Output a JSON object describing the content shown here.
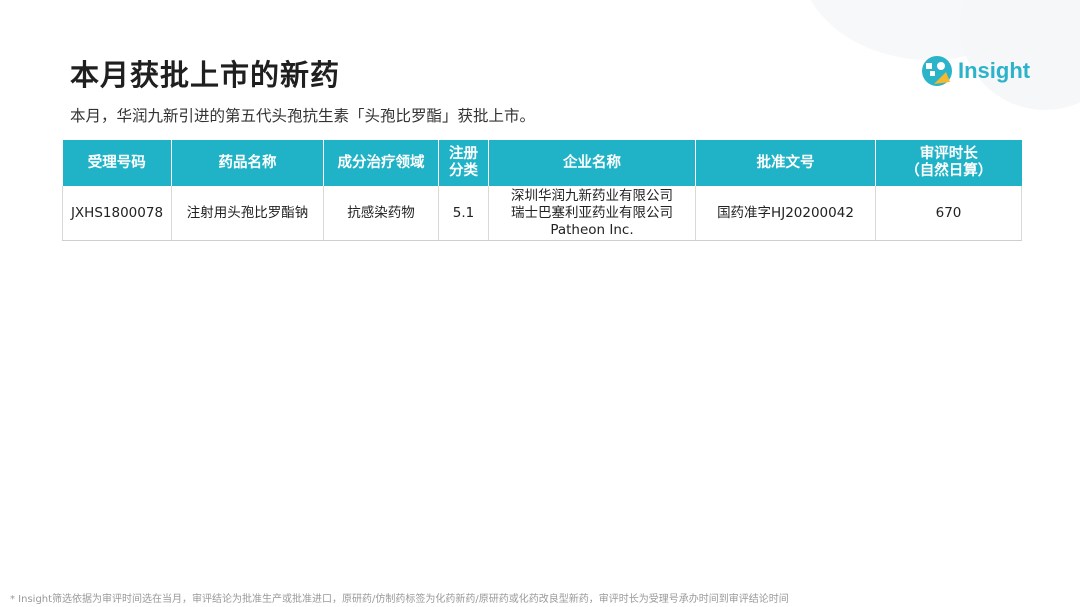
{
  "page": {
    "title": "本月获批上市的新药",
    "subtitle": "本月，华润九新引进的第五代头孢抗生素「头孢比罗酯」获批上市。",
    "footnote": "* Insight筛选依据为审评时间选在当月，审评结论为批准生产或批准进口，原研药/仿制药标签为化药新药/原研药或化药改良型新药，审评时长为受理号承办时间到审评结论时间"
  },
  "logo": {
    "text": "Insight",
    "icon": "insight-logo-icon",
    "color": "#2bb3c9"
  },
  "colors": {
    "header_bg": "#20b2c6",
    "header_text": "#ffffff"
  },
  "table": {
    "headers": [
      [
        "受理号码"
      ],
      [
        "药品名称"
      ],
      [
        "成分治疗领域"
      ],
      [
        "注册",
        "分类"
      ],
      [
        "企业名称"
      ],
      [
        "批准文号"
      ],
      [
        "审评时长",
        "（自然日算）"
      ]
    ],
    "rows": [
      {
        "cells": [
          [
            "JXHS1800078"
          ],
          [
            "注射用头孢比罗酯钠"
          ],
          [
            "抗感染药物"
          ],
          [
            "5.1"
          ],
          [
            "深圳华润九新药业有限公司",
            "瑞士巴塞利亚药业有限公司",
            "Patheon Inc."
          ],
          [
            "国药准字HJ20200042"
          ],
          [
            "670"
          ]
        ]
      }
    ]
  }
}
